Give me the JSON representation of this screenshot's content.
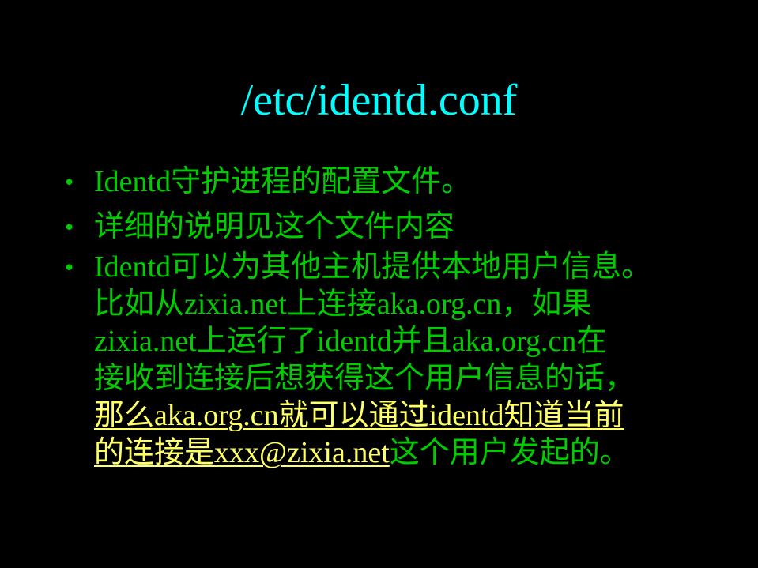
{
  "slide": {
    "title": "/etc/identd.conf",
    "bullet_symbol": "•",
    "bullets": [
      {
        "text": "Identd守护进程的配置文件。"
      },
      {
        "text": "详细的说明见这个文件内容"
      },
      {
        "lines": [
          "Identd可以为其他主机提供本地用户信息。",
          "比如从zixia.net上连接aka.org.cn，如果",
          "zixia.net上运行了identd并且aka.org.cn在",
          "接收到连接后想获得这个用户信息的话，"
        ],
        "highlight_line": "那么aka.org.cn就可以通过identd知道当前",
        "highlight_tail": "的连接是xxx@zixia.net",
        "final_tail": "这个用户发起的。"
      }
    ],
    "colors": {
      "background": "#000000",
      "title": "#00ffff",
      "body": "#00cc00",
      "highlight": "#ffff66"
    }
  }
}
